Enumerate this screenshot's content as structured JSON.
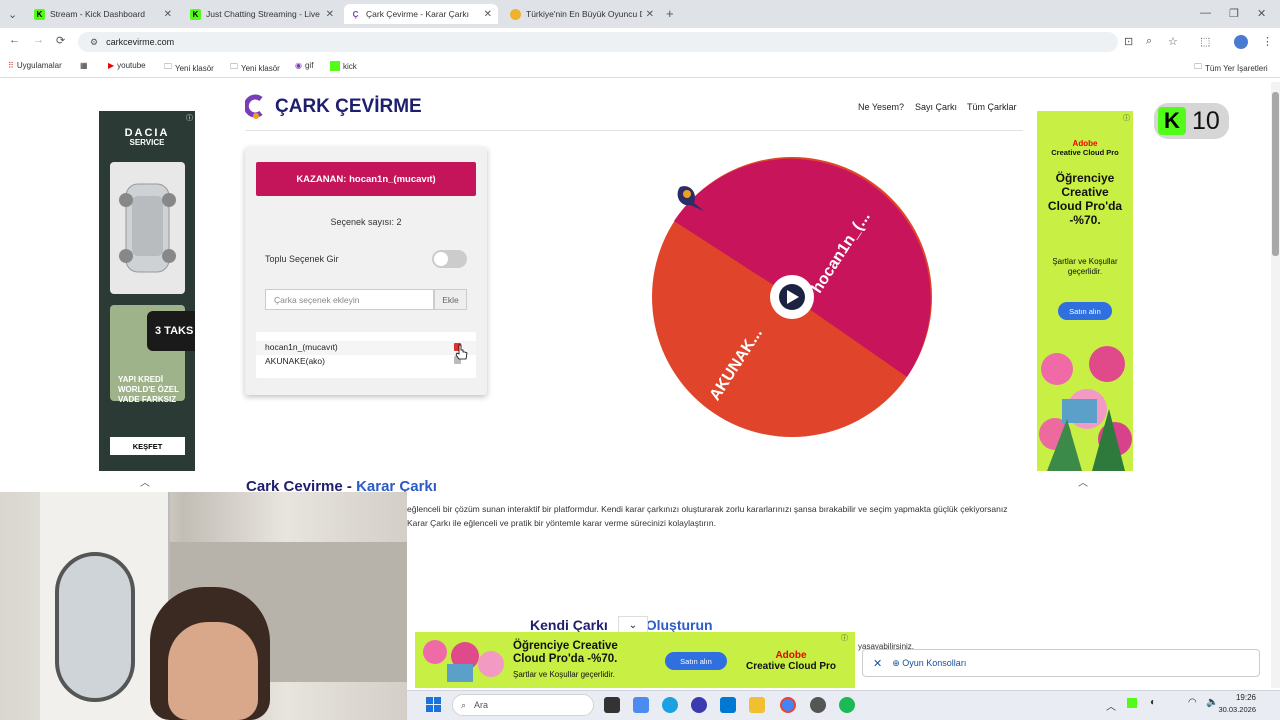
{
  "browser": {
    "tabs": [
      {
        "label": "Stream - Kick Dashboard",
        "active": false
      },
      {
        "label": "Just Chatting Streaming - Live",
        "active": false
      },
      {
        "label": "Çark Çevirme - Karar Çarkı",
        "active": true
      },
      {
        "label": "Türkiye'nin En Büyük Oyuncu D",
        "active": false
      }
    ],
    "url": "carkcevirme.com",
    "bookmarks": [
      "Uygulamalar",
      "youtube",
      "Yeni klasör",
      "Yeni klasör",
      "gif",
      "kick"
    ],
    "all_bookmarks": "Tüm Yer İşaretleri"
  },
  "site": {
    "title": "ÇARK ÇEVİRME",
    "nav": [
      "Ne Yesem?",
      "Sayı Çarkı",
      "Tüm Çarklar"
    ],
    "winner": "KAZANAN: hocan1n_(mucavıt)",
    "option_count": "Seçenek sayısı: 2",
    "bulk_label": "Toplu Seçenek Gir",
    "input_placeholder": "Çarka seçenek ekleyin",
    "add_label": "Ekle",
    "options": [
      "hocan1n_(mucavıt)",
      "AKUNAKE(ako)"
    ],
    "wheel": {
      "segments": [
        {
          "label": "hocan1n_(...",
          "color": "#c8145a"
        },
        {
          "label": "AKUNAK...",
          "color": "#e0442a"
        }
      ]
    },
    "heading_main": "Cark Cevirme - ",
    "heading_accent": "Karar Çarkı",
    "paragraph": "eğlenceli bir çözüm sunan interaktif bir platformdur. Kendi karar çarkınızı oluşturarak zorlu kararlarınızı şansa bırakabilir ve seçim yapmakta güçlük çekiyorsanız Karar Çarkı ile eğlenceli ve pratik bir yöntemle karar verme sürecinizi kolaylaştırın.",
    "sub_heading_main": "Kendi Çarkı",
    "sub_heading_accent": "Oluşturun",
    "sub_text_tail": "yaşayabilirsiniz."
  },
  "ads": {
    "left": {
      "brand": "DACIA",
      "service": "SERVICE",
      "promo": "3 TAKS",
      "bank": "YAPI KREDİ WORLD'E ÖZEL VADE FARKSIZ",
      "cta": "KEŞFET"
    },
    "right": {
      "brand": "Adobe",
      "product": "Creative Cloud Pro",
      "headline": "Öğrenciye Creative Cloud Pro'da -%70.",
      "terms": "Şartlar ve Koşullar geçerlidir.",
      "cta": "Satın alın"
    },
    "bottom": {
      "headline": "Öğrenciye Creative Cloud Pro'da -%70.",
      "terms": "Şartlar ve Koşullar geçerlidir.",
      "cta": "Satın alın",
      "brand": "Adobe",
      "product": "Creative Cloud Pro"
    }
  },
  "game_bar": {
    "label": "Oyun Konsolları"
  },
  "kick_badge": {
    "letter": "K",
    "count": "10"
  },
  "taskbar": {
    "search": "Ara",
    "time": "19:26",
    "date": "30.03.2026"
  }
}
